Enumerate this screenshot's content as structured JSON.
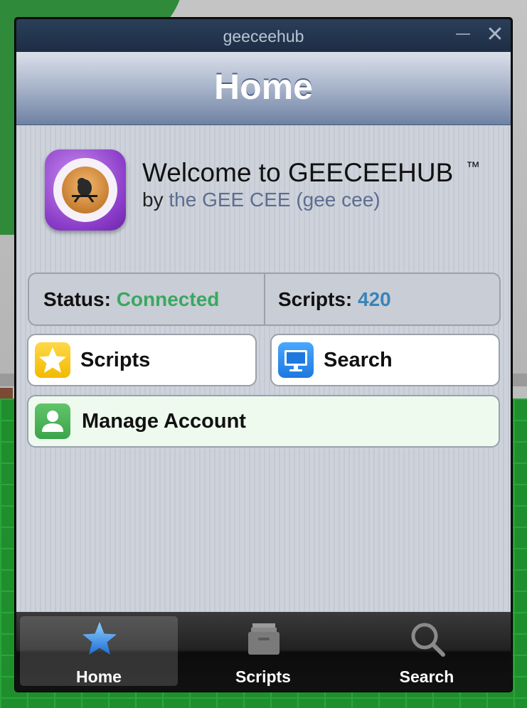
{
  "window": {
    "title": "geeceehub",
    "close_glyph": "✕"
  },
  "navbar": {
    "title": "Home"
  },
  "header": {
    "welcome": "Welcome to GEECEEHUB",
    "trademark": "™",
    "by_prefix": "by",
    "author": "the GEE CEE (gee cee)",
    "app_icon": "app-logo-icon"
  },
  "status": {
    "status_label": "Status:",
    "status_value": "Connected",
    "scripts_label": "Scripts:",
    "scripts_count": "420"
  },
  "actions": {
    "scripts": {
      "label": "Scripts",
      "icon": "star-icon"
    },
    "search": {
      "label": "Search",
      "icon": "monitor-icon"
    },
    "account": {
      "label": "Manage Account",
      "icon": "user-icon"
    }
  },
  "tabbar": {
    "tabs": [
      {
        "label": "Home",
        "icon": "star-icon",
        "active": true
      },
      {
        "label": "Scripts",
        "icon": "archive-icon",
        "active": false
      },
      {
        "label": "Search",
        "icon": "magnifier-icon",
        "active": false
      }
    ]
  },
  "colors": {
    "connected": "#3aa860",
    "count": "#3b84b8",
    "author": "#5d6d8f",
    "account_button_bg": "#eefaee"
  }
}
